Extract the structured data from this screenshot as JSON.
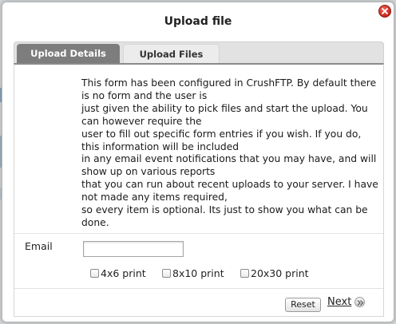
{
  "dialog": {
    "title": "Upload file"
  },
  "tabs": [
    {
      "label": "Upload Details",
      "active": true
    },
    {
      "label": "Upload Files",
      "active": false
    }
  ],
  "form": {
    "description": "This form has been configured in CrushFTP. By default there is no form and the user is\njust given the ability to pick files and start the upload. You can however require the\nuser to fill out specific form entries if you wish. If you do, this information will be included\nin any email event notifications that you may have, and will show up on various reports\nthat you can run about recent uploads to your server. I have not made any items required,\nso every item is optional. Its just to show you what can be done.",
    "email_label": "Email",
    "email_value": "",
    "options": [
      {
        "label": "4x6 print",
        "checked": false
      },
      {
        "label": "8x10 print",
        "checked": false
      },
      {
        "label": "20x30 print",
        "checked": false
      }
    ]
  },
  "buttons": {
    "reset_label": "Reset",
    "next_label": "Next"
  },
  "icons": {
    "close": "close-icon",
    "next": "next-arrow-icon"
  },
  "colors": {
    "close_button": "#d9342b",
    "active_tab": "#7d7d7d"
  }
}
